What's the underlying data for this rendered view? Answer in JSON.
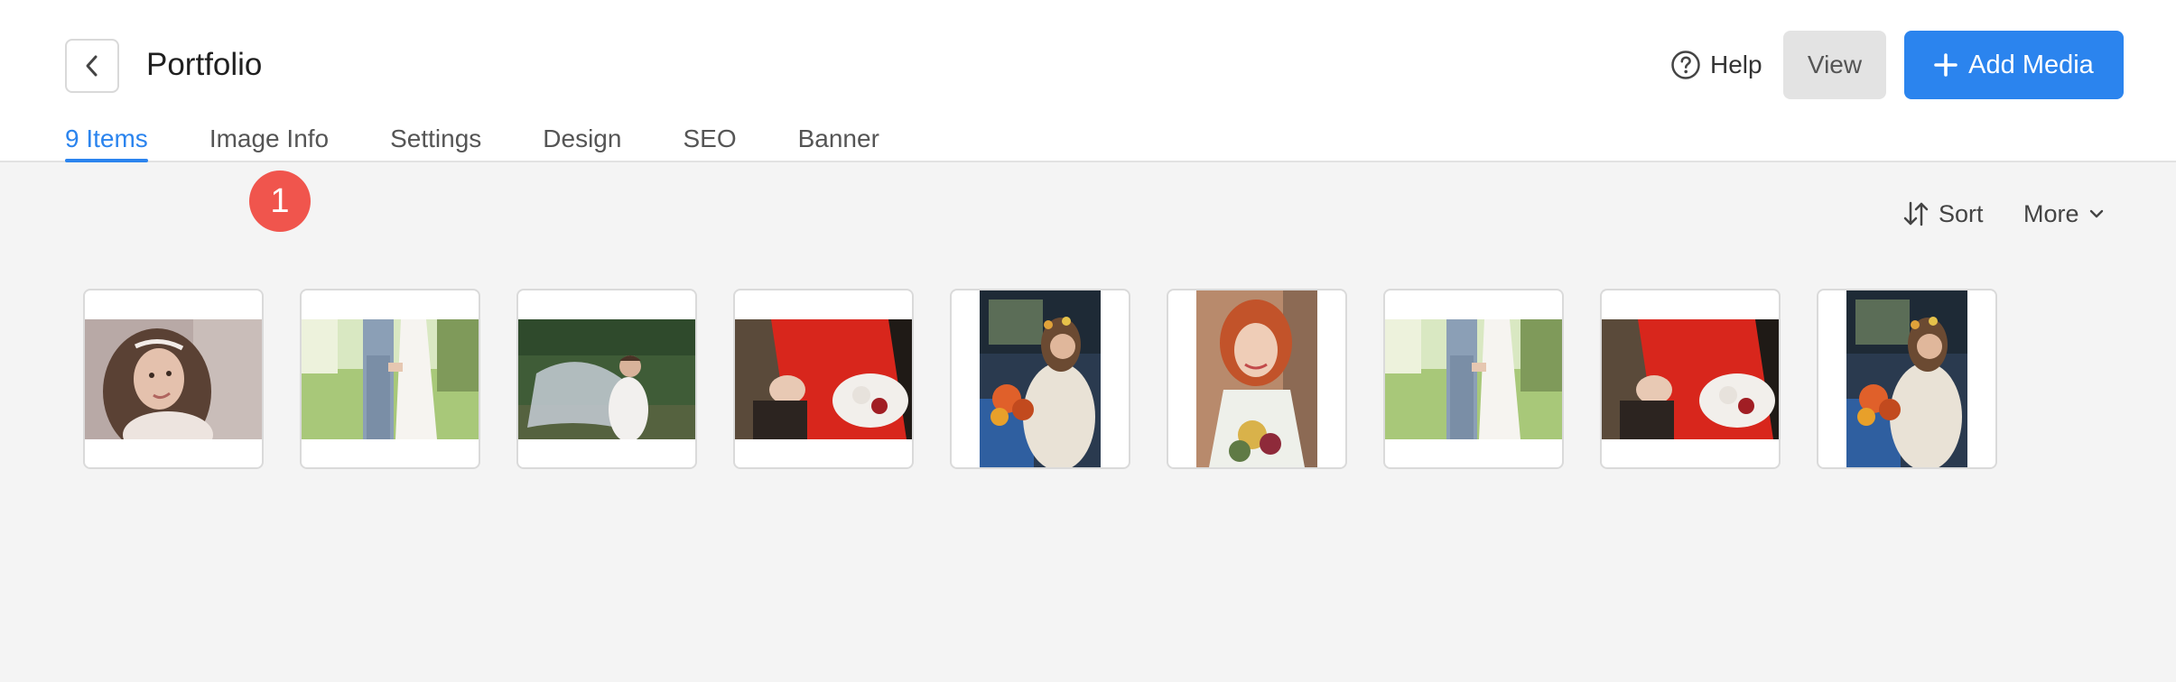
{
  "header": {
    "title": "Portfolio",
    "help_label": "Help",
    "view_label": "View",
    "add_label": "Add Media"
  },
  "tabs": [
    {
      "label": "9 Items",
      "active": true
    },
    {
      "label": "Image Info",
      "active": false
    },
    {
      "label": "Settings",
      "active": false
    },
    {
      "label": "Design",
      "active": false
    },
    {
      "label": "SEO",
      "active": false
    },
    {
      "label": "Banner",
      "active": false
    }
  ],
  "step_badge": "1",
  "toolbar": {
    "sort_label": "Sort",
    "more_label": "More"
  },
  "colors": {
    "accent": "#2b84ee",
    "badge": "#f0554d"
  },
  "media": [
    {
      "name": "bride-portrait-tiara",
      "orientation": "landscape"
    },
    {
      "name": "couple-holding-hands-field",
      "orientation": "landscape"
    },
    {
      "name": "bride-with-veil-forest",
      "orientation": "landscape"
    },
    {
      "name": "red-dress-bouquet",
      "orientation": "landscape"
    },
    {
      "name": "bride-in-vintage-car",
      "orientation": "portrait"
    },
    {
      "name": "redhead-bride-bouquet",
      "orientation": "portrait"
    },
    {
      "name": "couple-holding-hands-field",
      "orientation": "landscape"
    },
    {
      "name": "red-dress-bouquet",
      "orientation": "landscape"
    },
    {
      "name": "bride-in-vintage-car",
      "orientation": "portrait"
    }
  ]
}
